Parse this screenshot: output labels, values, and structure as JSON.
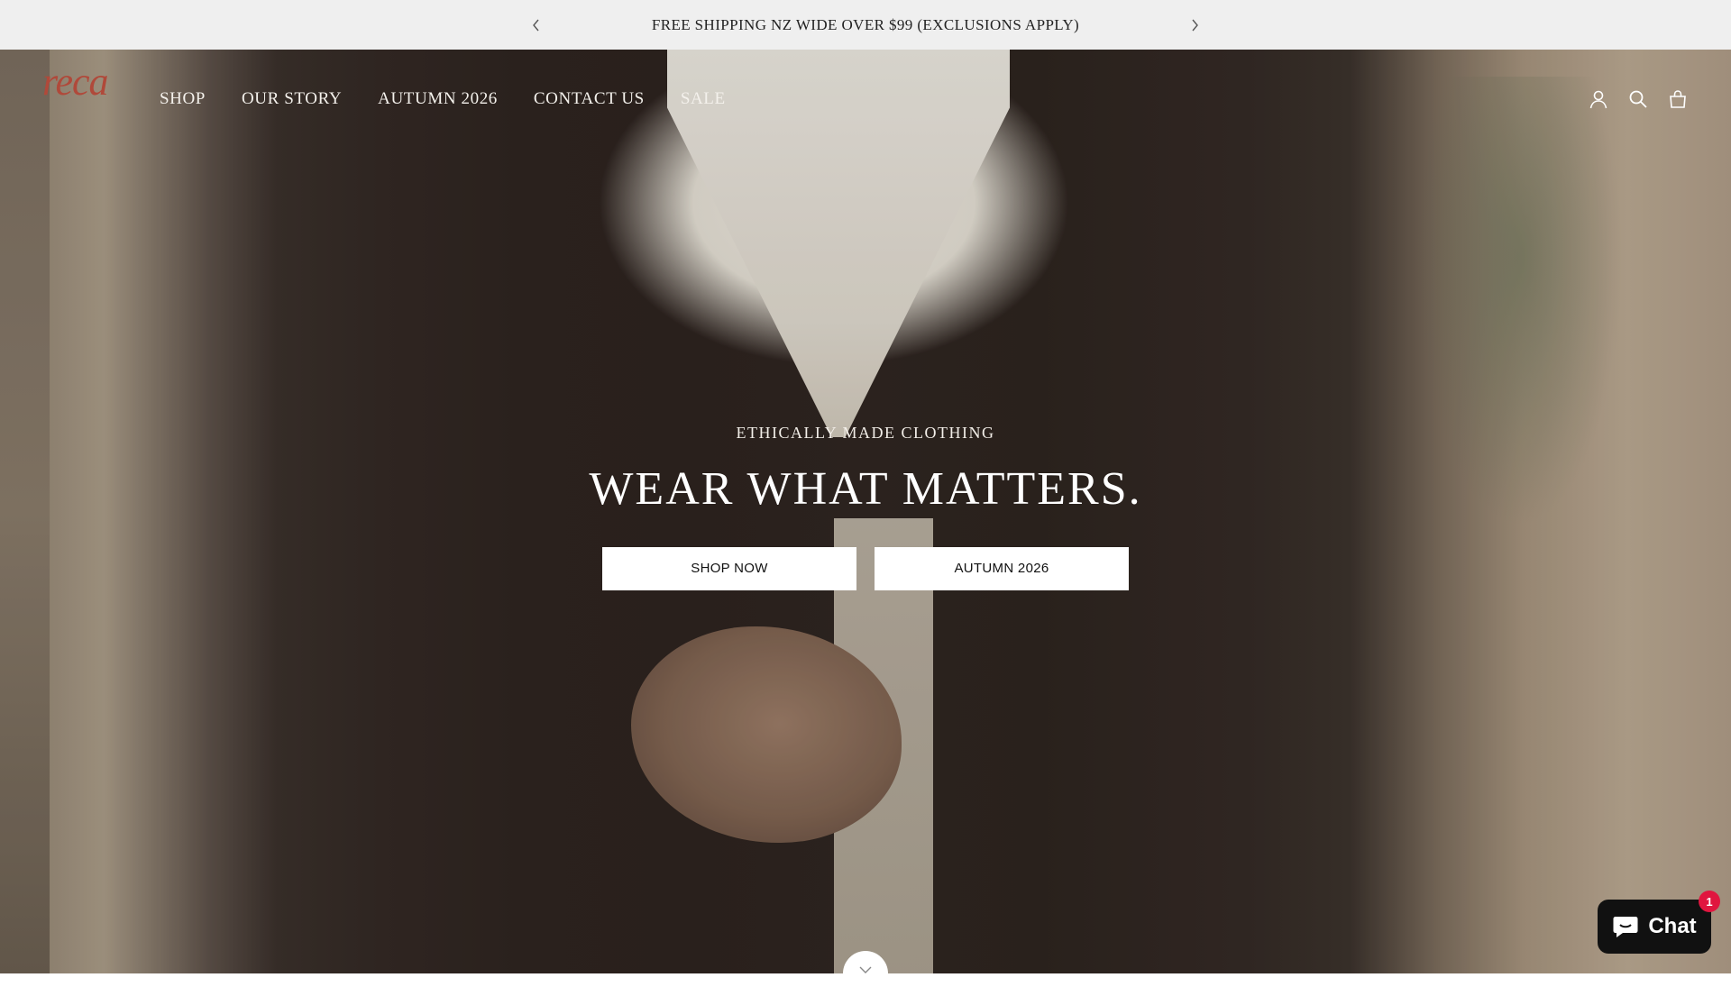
{
  "announcement": {
    "text": "FREE SHIPPING NZ WIDE OVER $99 (EXCLUSIONS APPLY)",
    "prev_icon": "chevron-left-icon",
    "next_icon": "chevron-right-icon"
  },
  "header": {
    "logo": "reca",
    "nav": [
      {
        "label": "SHOP"
      },
      {
        "label": "OUR STORY"
      },
      {
        "label": "AUTUMN 2026"
      },
      {
        "label": "CONTACT US"
      },
      {
        "label": "SALE"
      }
    ],
    "icons": [
      "account-icon",
      "search-icon",
      "cart-icon"
    ]
  },
  "hero": {
    "eyebrow": "ETHICALLY MADE CLOTHING",
    "headline": "WEAR WHAT MATTERS.",
    "buttons": [
      {
        "label": "SHOP NOW"
      },
      {
        "label": "AUTUMN 2026"
      }
    ],
    "scroll_icon": "chevron-down-icon"
  },
  "chat": {
    "label": "Chat",
    "badge": "1",
    "icon": "chat-bubble-icon"
  },
  "colors": {
    "logo": "#b0493a",
    "announcement_bg": "#efefef",
    "chat_bg": "#111111",
    "chat_badge": "#e0163f"
  }
}
